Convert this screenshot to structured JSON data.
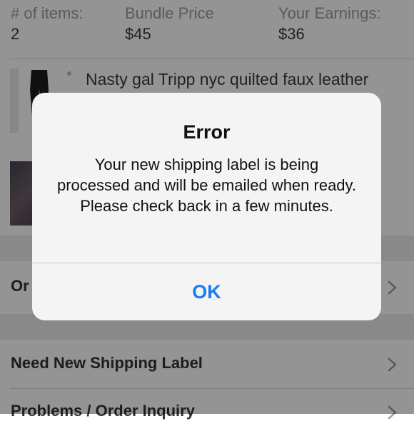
{
  "summary": {
    "items_label": "# of items:",
    "items_value": "2",
    "bundle_label": "Bundle Price",
    "bundle_value": "$45",
    "earnings_label": "Your Earnings:",
    "earnings_value": "$36"
  },
  "items": [
    {
      "title": "Nasty gal Tripp nyc quilted faux leather"
    }
  ],
  "rows": [
    {
      "label": "Or"
    },
    {
      "label": "Need New Shipping Label"
    },
    {
      "label": "Problems / Order Inquiry"
    }
  ],
  "alert": {
    "title": "Error",
    "message": "Your new shipping label is being processed and will be emailed when ready. Please check back in a few minutes.",
    "ok_label": "OK"
  },
  "icons": {
    "row_chevron": "chevron-right-icon"
  },
  "colors": {
    "accent": "#1a7ef0",
    "overlay": "rgba(0,0,0,0.42)"
  }
}
